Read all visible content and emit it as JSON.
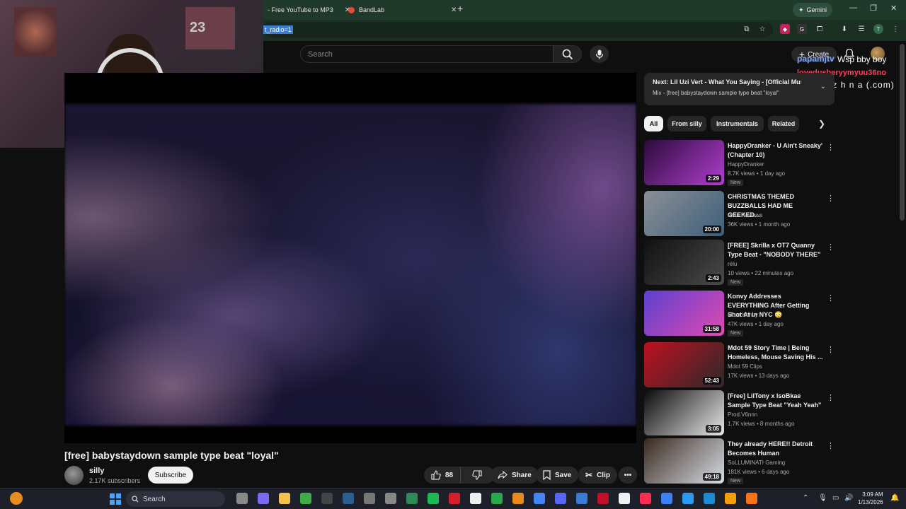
{
  "browser": {
    "tabs": [
      {
        "label": "- Free YouTube to MP3"
      },
      {
        "label": "BandLab"
      }
    ],
    "gemini_label": "Gemini",
    "url_fragment": "t_radio=1"
  },
  "youtube": {
    "search_placeholder": "Search",
    "create_label": "Create"
  },
  "overlays": {
    "chat1_user": "papamjtv",
    "chat1_msg": "Wsp bby boy",
    "chat2_user": "lovedusheryymyuu36no",
    "chat2_msg": "n — n e z h n a (.com)"
  },
  "webcam": {
    "jersey_number": "23"
  },
  "video": {
    "title": "[free] babystaydown sample type beat \"loyal\"",
    "channel": "silly",
    "subscribers": "2.17K subscribers",
    "subscribe_label": "Subscribe",
    "likes": "88",
    "share_label": "Share",
    "save_label": "Save",
    "clip_label": "Clip"
  },
  "up_next": {
    "line1": "Next: Lil Uzi Vert - What You Saying - [Official Music",
    "line2": "Mix - [free] babystaydown sample type beat \"loyal\""
  },
  "chips": [
    "All",
    "From silly",
    "Instrumentals",
    "Related"
  ],
  "recommendations": [
    {
      "title": "HappyDranker - U Ain't Sneaky' (Chapter 10)",
      "channel": "HappyDranker",
      "meta": "8.7K views • 1 day ago",
      "badge": "New",
      "duration": "2:29",
      "colors": [
        "#2a0b3a",
        "#b13ed0"
      ]
    },
    {
      "title": "CHRISTMAS THEMED BUZZBALLS HAD ME GEEKED...",
      "channel": "Aron Reviews",
      "meta": "36K views • 1 month ago",
      "badge": "",
      "duration": "20:00",
      "colors": [
        "#8a8f96",
        "#3e5f7a"
      ]
    },
    {
      "title": "[FREE] Skrilla x OT7 Quanny Type Beat - \"NOBODY THERE\"",
      "channel": "rélu",
      "meta": "10 views • 22 minutes ago",
      "badge": "New",
      "duration": "2:43",
      "colors": [
        "#111111",
        "#4a4a4a"
      ]
    },
    {
      "title": "Konvy Addresses EVERYTHING After Getting Shot At in NYC 😳",
      "channel": "More Konvy",
      "meta": "47K views • 1 day ago",
      "badge": "New",
      "duration": "31:58",
      "colors": [
        "#5b3fd0",
        "#e04ab0"
      ]
    },
    {
      "title": "Mdot 59 Story Time | Being Homeless, Mouse Saving His ...",
      "channel": "Mdot 59 Clips",
      "meta": "17K views • 13 days ago",
      "badge": "",
      "duration": "52:43",
      "colors": [
        "#c01020",
        "#2a2a2a"
      ]
    },
    {
      "title": "[Free] LilTony x IsoBkae Sample Type Beat \"Yeah Yeah\"",
      "channel": "Prod.V6nnn",
      "meta": "1.7K views • 8 months ago",
      "badge": "",
      "duration": "3:05",
      "colors": [
        "#0a0a0a",
        "#e8e8e8"
      ]
    },
    {
      "title": "They already HERE!! Detroit Becomes Human",
      "channel": "SoLLUMINATI Gaming",
      "meta": "181K views • 6 days ago",
      "badge": "New",
      "duration": "49:18",
      "colors": [
        "#3a2a20",
        "#d8dde6"
      ]
    }
  ],
  "taskbar": {
    "search_label": "Search",
    "time": "3:09 AM",
    "date": "1/13/2026"
  }
}
